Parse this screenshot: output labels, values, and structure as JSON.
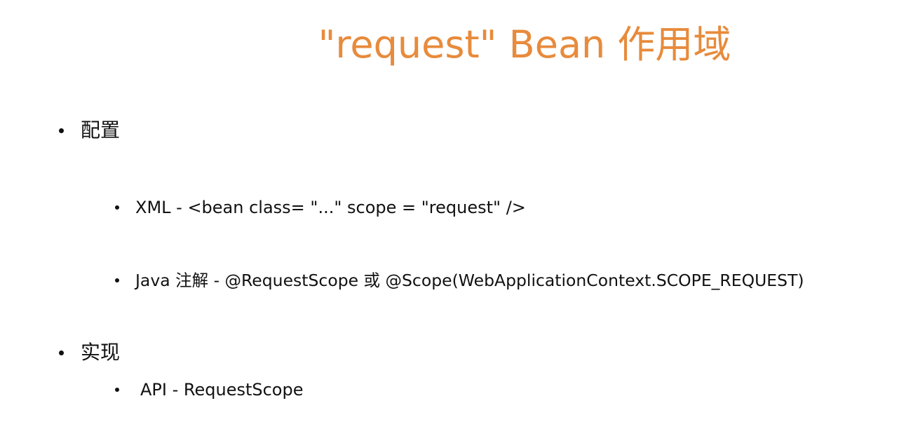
{
  "slide": {
    "title": "\"request\" Bean 作用域",
    "colors": {
      "title": "#E78B3C",
      "text": "#111111",
      "background": "#ffffff"
    }
  },
  "bullets": {
    "config": {
      "label": "配置",
      "xml": "XML - <bean class= \"...\" scope  = \"request\" />",
      "java": "Java 注解 - @RequestScope 或 @Scope(WebApplicationContext.SCOPE_REQUEST)"
    },
    "impl": {
      "label": "实现",
      "api": "API - RequestScope"
    }
  }
}
